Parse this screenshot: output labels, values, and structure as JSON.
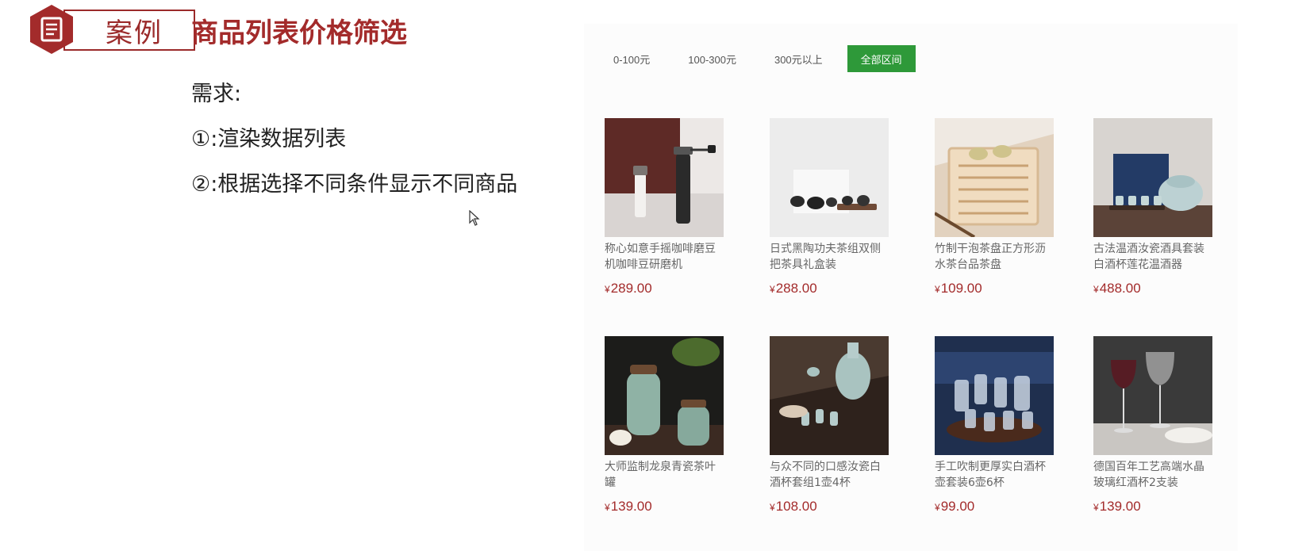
{
  "slide": {
    "badge_label": "案例",
    "title": "商品列表价格筛选",
    "requirements": [
      "需求:",
      "①:渲染数据列表",
      "②:根据选择不同条件显示不同商品"
    ],
    "accent_color": "#a32b2b"
  },
  "demo": {
    "filters": [
      {
        "label": "0-100元",
        "active": false
      },
      {
        "label": "100-300元",
        "active": false
      },
      {
        "label": "300元以上",
        "active": false
      },
      {
        "label": "全部区间",
        "active": true
      }
    ],
    "active_color": "#2e9939",
    "currency": "¥",
    "products": [
      {
        "name": "称心如意手摇咖啡磨豆机咖啡豆研磨机",
        "price": "289.00",
        "image": "coffee-grinder"
      },
      {
        "name": "日式黑陶功夫茶组双侧把茶具礼盒装",
        "price": "288.00",
        "image": "black-tea-set"
      },
      {
        "name": "竹制干泡茶盘正方形沥水茶台品茶盘",
        "price": "109.00",
        "image": "bamboo-tea-tray"
      },
      {
        "name": "古法温酒汝瓷酒具套装白酒杯莲花温酒器",
        "price": "488.00",
        "image": "ru-porcelain-wine-set"
      },
      {
        "name": "大师监制龙泉青瓷茶叶罐",
        "price": "139.00",
        "image": "celadon-tea-jar"
      },
      {
        "name": "与众不同的口感汝瓷白酒杯套组1壶4杯",
        "price": "108.00",
        "image": "ru-porcelain-cup-set"
      },
      {
        "name": "手工吹制更厚实白酒杯壶套装6壶6杯",
        "price": "99.00",
        "image": "glass-cup-set"
      },
      {
        "name": "德国百年工艺高端水晶玻璃红酒杯2支装",
        "price": "139.00",
        "image": "crystal-wine-glasses"
      }
    ]
  }
}
